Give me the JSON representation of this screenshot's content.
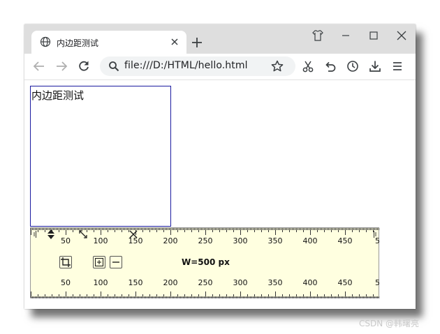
{
  "browser": {
    "tab_title": "内边距测试",
    "url": "file:///D:/HTML/hello.html"
  },
  "page": {
    "box_text": "内边距测试"
  },
  "ruler": {
    "width_label": "W=500 px",
    "tick_labels": [
      "50",
      "100",
      "150",
      "200",
      "250",
      "300",
      "350",
      "400",
      "450",
      "50"
    ]
  },
  "watermark": "CSDN @韩曙亮",
  "icons": {
    "tab": "globe-icon",
    "close": "close-icon",
    "new_tab": "plus-icon",
    "window": [
      "customize-icon",
      "minimize-icon",
      "maximize-icon",
      "close-icon"
    ],
    "toolbar": [
      "back-icon",
      "forward-icon",
      "reload-icon",
      "search-icon",
      "star-icon",
      "cut-icon",
      "undo-icon",
      "history-icon",
      "download-icon",
      "menu-icon"
    ],
    "ruler": [
      "grip-icon",
      "up-down-arrows-icon",
      "crop-icon",
      "resize-icon",
      "center-icon",
      "minus-icon",
      "close-icon",
      "grip-icon"
    ]
  },
  "colors": {
    "ruler_background": "#ffffe0",
    "box_border": "#1a1aa0",
    "tabstrip": "#dedede",
    "omnibox": "#f1f3f4"
  }
}
